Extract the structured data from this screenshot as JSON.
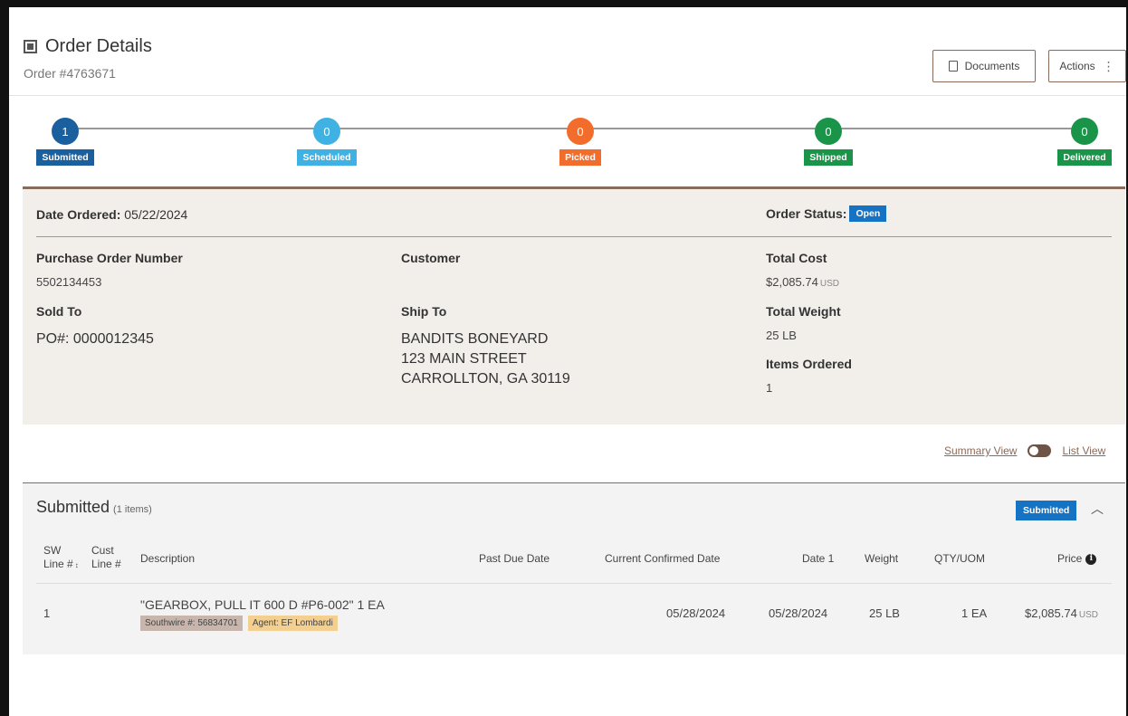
{
  "header": {
    "title": "Order Details",
    "order_number": "Order #4763671",
    "documents_label": "Documents",
    "actions_label": "Actions"
  },
  "progress": {
    "steps": [
      {
        "count": "1",
        "label": "Submitted",
        "color": "#1a5f9e"
      },
      {
        "count": "0",
        "label": "Scheduled",
        "color": "#3fb1e3"
      },
      {
        "count": "0",
        "label": "Picked",
        "color": "#f26d2c"
      },
      {
        "count": "0",
        "label": "Shipped",
        "color": "#1a9448"
      },
      {
        "count": "0",
        "label": "Delivered",
        "color": "#1a9448"
      }
    ]
  },
  "order": {
    "date_ordered_label": "Date Ordered:",
    "date_ordered": "05/22/2024",
    "order_status_label": "Order Status:",
    "order_status": "Open",
    "po_label": "Purchase Order Number",
    "po_value": "5502134453",
    "customer_label": "Customer",
    "total_cost_label": "Total Cost",
    "total_cost": "$2,085.74",
    "currency": "USD",
    "sold_to_label": "Sold To",
    "sold_to_value": "PO#: 0000012345",
    "ship_to_label": "Ship To",
    "ship_to_line1": "BANDITS BONEYARD",
    "ship_to_line2": "123 MAIN STREET",
    "ship_to_line3": "CARROLLTON, GA 30119",
    "total_weight_label": "Total Weight",
    "total_weight": "25 LB",
    "items_ordered_label": "Items Ordered",
    "items_ordered": "1"
  },
  "view_toggle": {
    "summary_label": "Summary View",
    "list_label": "List View"
  },
  "section": {
    "title": "Submitted",
    "count": "(1 items)",
    "badge": "Submitted",
    "columns": {
      "sw_line_1": "SW",
      "sw_line_2": "Line #",
      "sort_mark": "↕",
      "cust_line_1": "Cust",
      "cust_line_2": "Line #",
      "description": "Description",
      "past_due": "Past Due Date",
      "confirmed": "Current Confirmed Date",
      "date1": "Date 1",
      "weight": "Weight",
      "qty": "QTY/UOM",
      "price": "Price"
    },
    "rows": [
      {
        "sw_line": "1",
        "cust_line": "",
        "description": "\"GEARBOX, PULL IT 600 D #P6-002\" 1 EA",
        "southwire_tag": "Southwire #: 56834701",
        "agent_tag": "Agent: EF Lombardi",
        "past_due": "",
        "confirmed": "05/28/2024",
        "date1": "05/28/2024",
        "weight": "25 LB",
        "qty": "1 EA",
        "price": "$2,085.74",
        "currency": "USD"
      }
    ]
  }
}
